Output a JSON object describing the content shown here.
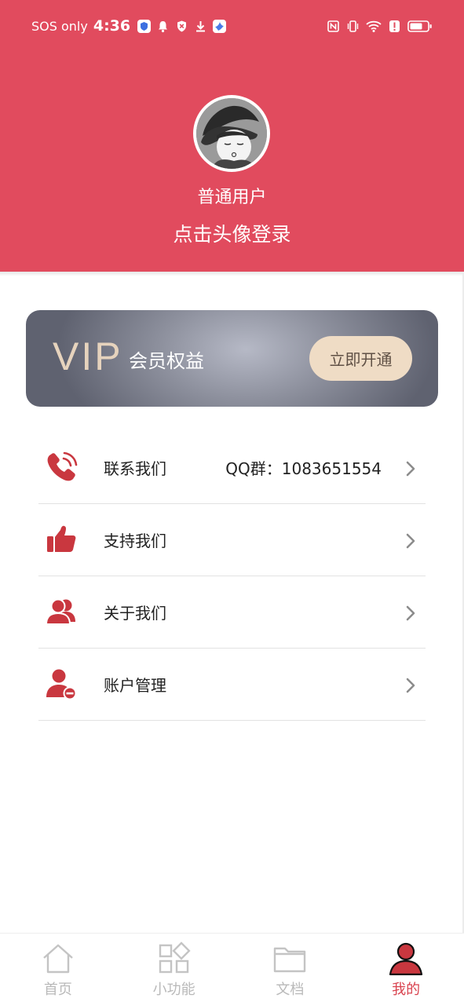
{
  "status_bar": {
    "sos": "SOS only",
    "time": "4:36"
  },
  "profile": {
    "username": "普通用户",
    "login_hint": "点击头像登录"
  },
  "vip": {
    "logo": "VIP",
    "title": "会员权益",
    "button": "立即开通"
  },
  "menu": {
    "items": [
      {
        "label": "联系我们",
        "extra": "QQ群：1083651554",
        "icon": "phone-icon"
      },
      {
        "label": "支持我们",
        "extra": "",
        "icon": "thumbs-up-icon"
      },
      {
        "label": "关于我们",
        "extra": "",
        "icon": "users-icon"
      },
      {
        "label": "账户管理",
        "extra": "",
        "icon": "user-remove-icon"
      }
    ]
  },
  "tabbar": {
    "items": [
      {
        "label": "首页",
        "icon": "home-icon"
      },
      {
        "label": "小功能",
        "icon": "apps-grid-icon"
      },
      {
        "label": "文档",
        "icon": "folder-icon"
      },
      {
        "label": "我的",
        "icon": "profile-icon"
      }
    ],
    "active_index": 3
  },
  "colors": {
    "brand": "#e14b5e",
    "icon_red": "#c9373f",
    "tab_active": "#d9434f",
    "tab_inactive": "#b9b9b9",
    "vip_button": "#efdcc5"
  }
}
